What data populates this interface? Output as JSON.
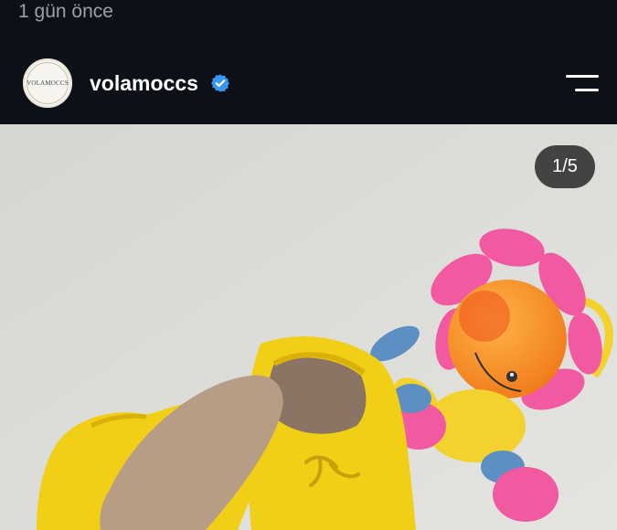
{
  "post": {
    "timestamp": "1 gün önce",
    "username": "volamoccs",
    "verified": true,
    "avatar_text": "VOLAMOCCS",
    "media_counter": "1/5"
  },
  "icons": {
    "verified": "verified-badge-icon",
    "menu": "menu-icon"
  },
  "colors": {
    "background": "#0d1117",
    "verified_blue": "#3897f0",
    "text": "#ffffff",
    "muted_text": "#9aa0a6"
  }
}
